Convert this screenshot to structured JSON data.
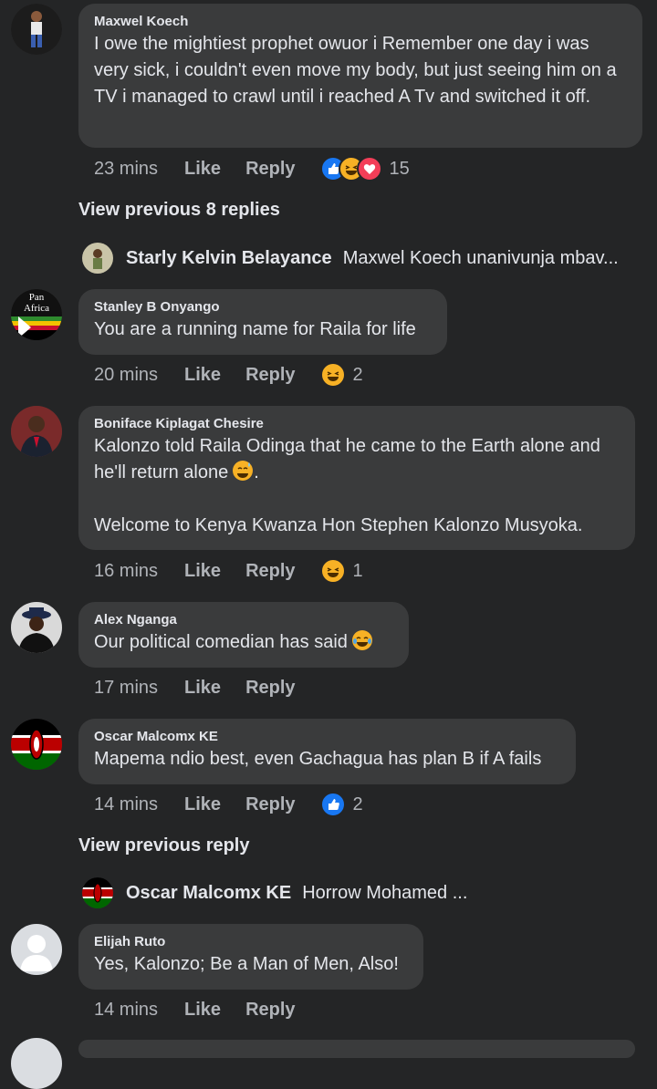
{
  "comments": [
    {
      "author": "Maxwel Koech",
      "text": "I owe the mightiest prophet owuor i Remember one day i was very sick, i couldn't even move my body, but just seeing him on a TV i managed to crawl until i reached A Tv and switched it off.",
      "time": "23 mins",
      "like": "Like",
      "reply": "Reply",
      "reactions": [
        "like",
        "haha",
        "love"
      ],
      "count": "15"
    },
    {
      "author": "Stanley B Onyango",
      "avatar_text_1": "Pan",
      "avatar_text_2": "Africa",
      "text": "You are a running name for Raila for life",
      "time": "20 mins",
      "like": "Like",
      "reply": "Reply",
      "reactions": [
        "haha"
      ],
      "count": "2"
    },
    {
      "author": "Boniface Kiplagat Chesire",
      "text_line1": "Kalonzo told Raila Odinga that he came to the Earth alone and he'll return alone",
      "text_line2": "Welcome to Kenya Kwanza Hon Stephen Kalonzo Musyoka.",
      "time": "16 mins",
      "like": "Like",
      "reply": "Reply",
      "reactions": [
        "haha"
      ],
      "count": "1"
    },
    {
      "author": "Alex Nganga",
      "text": "Our political comedian has said",
      "time": "17 mins",
      "like": "Like",
      "reply": "Reply"
    },
    {
      "author": "Oscar Malcomx KE",
      "text": "Mapema ndio best, even Gachagua has plan B if A fails",
      "time": "14 mins",
      "like": "Like",
      "reply": "Reply",
      "reactions": [
        "like"
      ],
      "count": "2"
    },
    {
      "author": "Elijah Ruto",
      "text": "Yes, Kalonzo; Be a Man of Men, Also!",
      "time": "14 mins",
      "like": "Like",
      "reply": "Reply"
    }
  ],
  "view_previous_1": "View previous 8 replies",
  "collapsed_1": {
    "name": "Starly Kelvin Belayance",
    "text": "Maxwel Koech unanivunja mbav..."
  },
  "view_previous_2": "View previous reply",
  "collapsed_2": {
    "name": "Oscar Malcomx KE",
    "text": "Horrow Mohamed ..."
  },
  "colors": {
    "background": "#242526",
    "bubble": "#3a3b3c",
    "text": "#e4e6eb",
    "secondary": "#b0b3b8",
    "like_blue": "#1877f2",
    "love_red": "#f33e58",
    "haha_yellow": "#f7b125"
  }
}
